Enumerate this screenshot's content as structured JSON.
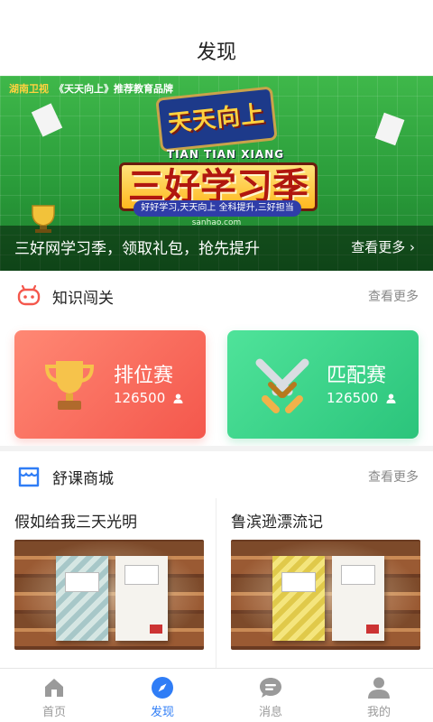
{
  "header": {
    "title": "发现"
  },
  "banner": {
    "topline_brand": "湖南卫视",
    "topline_text": "《天天向上》推荐教育品牌",
    "show_title": "天天向上",
    "show_pinyin": "TIAN TIAN XIANG SHANG",
    "headline": "三好学习季",
    "slogan": "好好学习,天天向上  全科提升,三好担当",
    "site": "sanhao.com",
    "caption": "三好网学习季，领取礼包，抢先提升",
    "more_label": "查看更多"
  },
  "quiz_section": {
    "icon": "gamepad-icon",
    "label": "知识闯关",
    "more_label": "查看更多",
    "cards": [
      {
        "title": "排位赛",
        "count": "126500",
        "icon": "trophy-icon",
        "color": "#f4574c"
      },
      {
        "title": "匹配赛",
        "count": "126500",
        "icon": "crossed-swords-icon",
        "color": "#2bc47b"
      }
    ]
  },
  "shop_section": {
    "icon": "shop-icon",
    "label": "舒课商城",
    "more_label": "查看更多",
    "books": [
      {
        "title": "假如给我三天光明"
      },
      {
        "title": "鲁滨逊漂流记"
      }
    ]
  },
  "tabbar": {
    "tabs": [
      {
        "label": "首页",
        "icon": "home-icon"
      },
      {
        "label": "发现",
        "icon": "compass-icon"
      },
      {
        "label": "消息",
        "icon": "message-icon"
      },
      {
        "label": "我的",
        "icon": "user-icon"
      }
    ],
    "active_color": "#2f7df6"
  }
}
